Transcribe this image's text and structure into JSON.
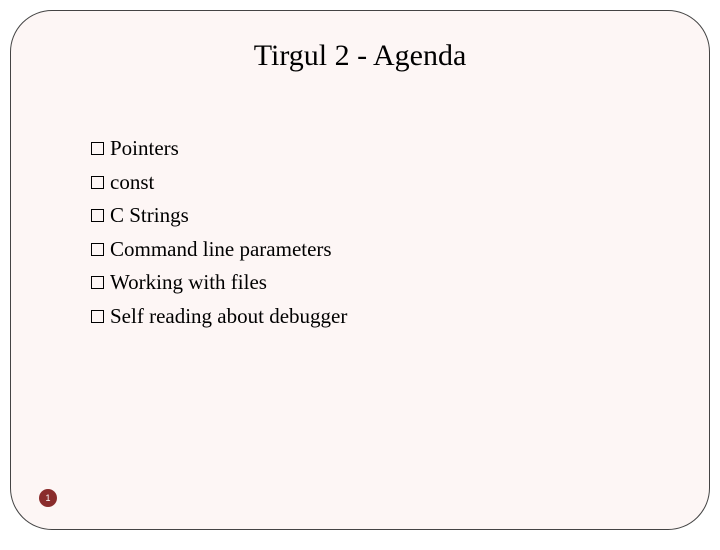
{
  "title": "Tirgul 2 - Agenda",
  "items": [
    {
      "label": "Pointers"
    },
    {
      "label": "const"
    },
    {
      "label": "C Strings"
    },
    {
      "label": "Command line parameters"
    },
    {
      "label": "Working with files"
    },
    {
      "label": "Self reading about debugger"
    }
  ],
  "page_number": "1"
}
